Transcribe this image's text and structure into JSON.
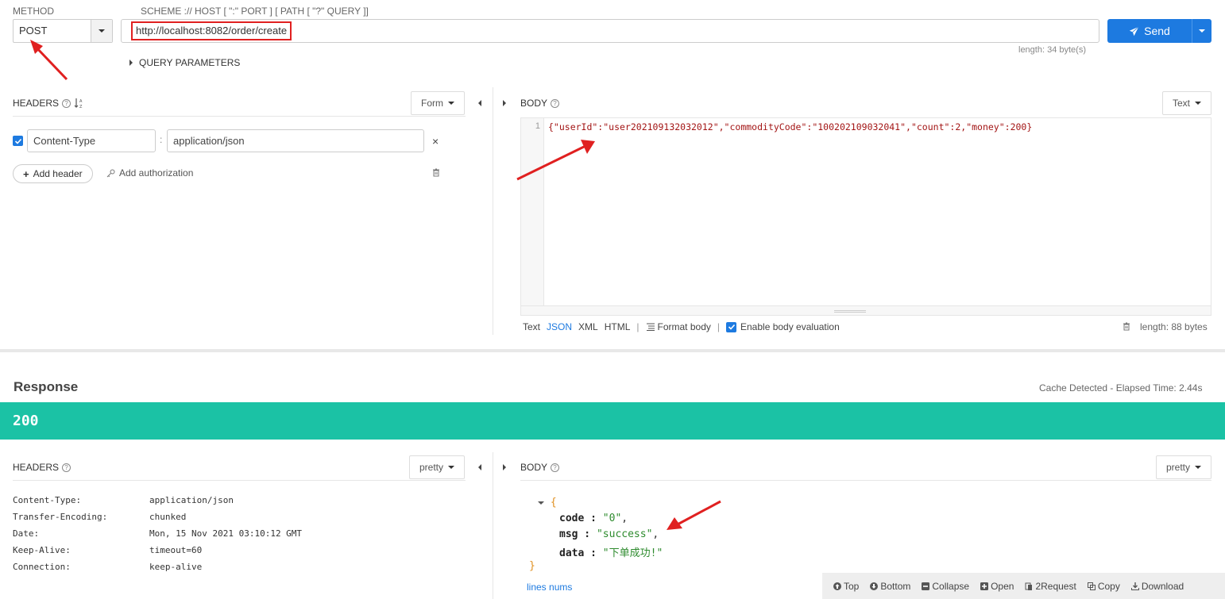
{
  "request": {
    "method_label": "METHOD",
    "method_value": "POST",
    "scheme_label": "SCHEME :// HOST [ \":\" PORT ] [ PATH [ \"?\" QUERY ]]",
    "url": "http://localhost:8082/order/create",
    "send_label": "Send",
    "length": "length: 34 byte(s)",
    "query_params": "QUERY PARAMETERS"
  },
  "req_headers": {
    "title": "HEADERS",
    "mode": "Form",
    "rows": [
      {
        "name": "Content-Type",
        "value": "application/json",
        "checked": true
      }
    ],
    "separator": ":",
    "remove_icon": "×",
    "add_header": "Add header",
    "add_authorization": "Add authorization"
  },
  "req_body": {
    "title": "BODY",
    "mode": "Text",
    "line_number": "1",
    "content": "{\"userId\":\"user202109132032012\",\"commodityCode\":\"100202109032041\",\"count\":2,\"money\":200}",
    "formats": [
      "Text",
      "JSON",
      "XML",
      "HTML"
    ],
    "active_format": "JSON",
    "separator": "|",
    "format_body": "Format body",
    "enable_eval": "Enable body evaluation",
    "length": "length: 88 bytes"
  },
  "response": {
    "title": "Response",
    "cache": "Cache Detected - Elapsed Time: 2.44s",
    "status": "200",
    "status_color": "#1bc2a5",
    "headers_title": "HEADERS",
    "headers_mode": "pretty",
    "headers": [
      {
        "name": "Content-Type:",
        "value": "application/json"
      },
      {
        "name": "Transfer-Encoding:",
        "value": "chunked"
      },
      {
        "name": "Date:",
        "value": "Mon, 15 Nov 2021 03:10:12 GMT"
      },
      {
        "name": "Keep-Alive:",
        "value": "timeout=60"
      },
      {
        "name": "Connection:",
        "value": "keep-alive"
      }
    ],
    "body_title": "BODY",
    "body_mode": "pretty",
    "json_open": "{",
    "json_close": "}",
    "json_fields": [
      {
        "key": "code",
        "value": "\"0\"",
        "trail": ","
      },
      {
        "key": "msg",
        "value": "\"success\"",
        "trail": ","
      },
      {
        "key": "data",
        "value": "\"下单成功!\"",
        "trail": ""
      }
    ],
    "lines_nums": "lines nums",
    "toolbar": [
      "Top",
      "Bottom",
      "Collapse",
      "Open",
      "2Request",
      "Copy",
      "Download"
    ]
  },
  "colors": {
    "accent": "#1d7ae0",
    "highlight_box": "#e02020",
    "arrow": "#e02020"
  }
}
